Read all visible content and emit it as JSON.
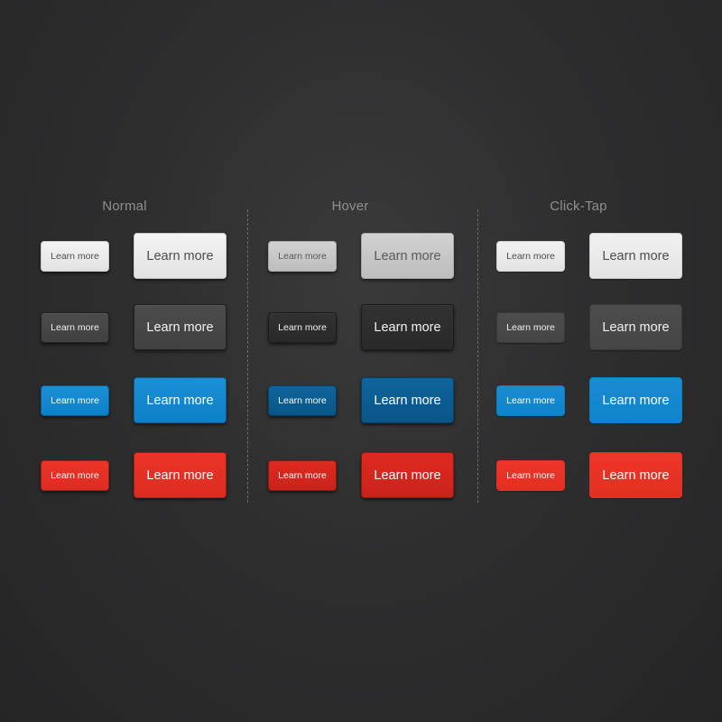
{
  "columns": {
    "normal": "Normal",
    "hover": "Hover",
    "click_tap": "Click-Tap"
  },
  "buttons": {
    "normal": {
      "light_small": "Learn more",
      "light_large": "Learn more",
      "dark_small": "Learn more",
      "dark_large": "Learn more",
      "blue_small": "Learn more",
      "blue_large": "Learn more",
      "red_small": "Learn more",
      "red_large": "Learn more"
    },
    "hover": {
      "light_small": "Learn more",
      "light_large": "Learn more",
      "dark_small": "Learn more",
      "dark_large": "Learn more",
      "blue_small": "Learn more",
      "blue_large": "Learn more",
      "red_small": "Learn more",
      "red_large": "Learn more"
    },
    "click_tap": {
      "light_small": "Learn more",
      "light_large": "Learn more",
      "dark_small": "Learn more",
      "dark_large": "Learn more",
      "blue_small": "Learn more",
      "blue_large": "Learn more",
      "red_small": "Learn more",
      "red_large": "Learn more"
    }
  },
  "colors": {
    "background": "#2e2e2f",
    "header_text": "#8f8f90",
    "light": "#e9e9e9",
    "dark": "#464647",
    "blue": "#1288d0",
    "red": "#e53126"
  }
}
